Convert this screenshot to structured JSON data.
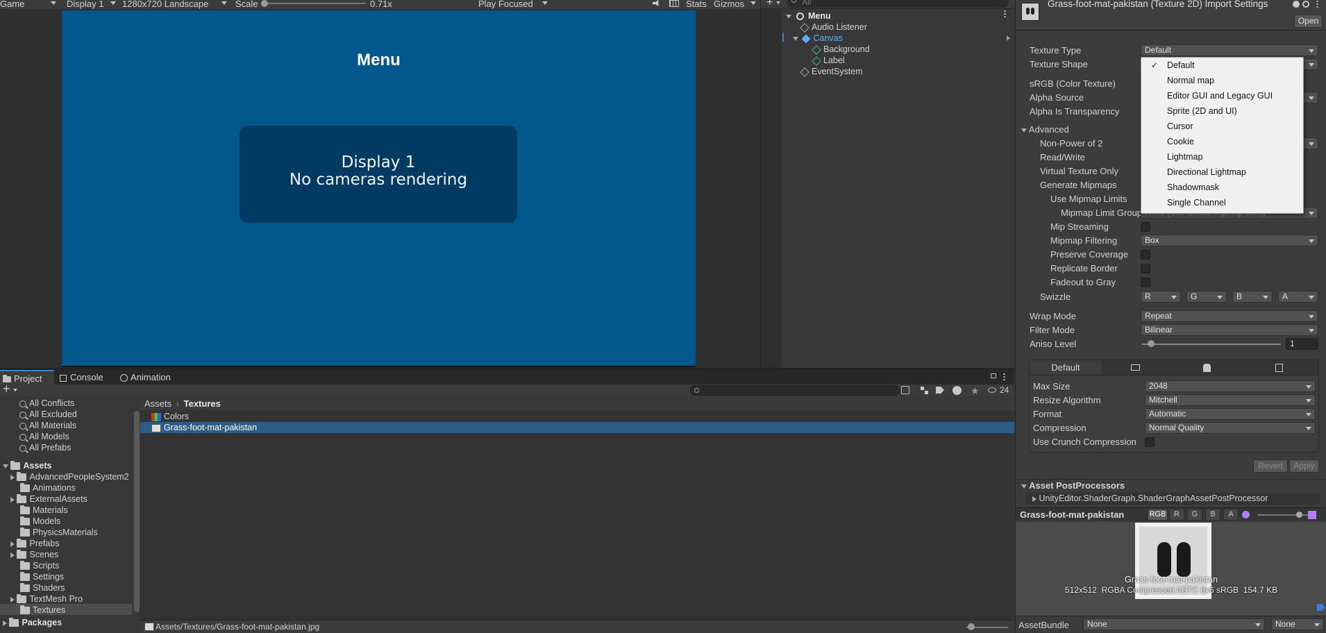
{
  "game_view": {
    "tab_label": "Game",
    "display": "Display 1",
    "resolution": "1280x720 Landscape",
    "scale_label": "Scale",
    "scale_value": "0.71x",
    "play_mode": "Play Focused",
    "stats": "Stats",
    "gizmos": "Gizmos",
    "canvas_title": "Menu",
    "no_camera_line1": "Display 1",
    "no_camera_line2": "No cameras rendering"
  },
  "hierarchy": {
    "search_placeholder": "All",
    "scene": "Menu",
    "items": [
      {
        "label": "Audio Listener"
      },
      {
        "label": "Canvas"
      },
      {
        "label": "Background"
      },
      {
        "label": "Label"
      },
      {
        "label": "EventSystem"
      }
    ]
  },
  "inspector": {
    "title": "Grass-foot-mat-pakistan (Texture 2D) Import Settings",
    "open_button": "Open",
    "texture_type_label": "Texture Type",
    "texture_type_value": "Default",
    "texture_shape_label": "Texture Shape",
    "srgb_label": "sRGB (Color Texture)",
    "alpha_source_label": "Alpha Source",
    "alpha_transparency_label": "Alpha Is Transparency",
    "advanced_label": "Advanced",
    "npot_label": "Non-Power of 2",
    "readwrite_label": "Read/Write",
    "virtual_texture_label": "Virtual Texture Only",
    "gen_mipmaps_label": "Generate Mipmaps",
    "use_mip_limits_label": "Use Mipmap Limits",
    "mip_limit_group_label": "Mipmap Limit Group",
    "mip_limit_group_value": "None (Use Global Mipmap Limit)",
    "mip_streaming_label": "Mip Streaming",
    "mip_filtering_label": "Mipmap Filtering",
    "mip_filtering_value": "Box",
    "preserve_coverage_label": "Preserve Coverage",
    "replicate_border_label": "Replicate Border",
    "fadeout_label": "Fadeout to Gray",
    "swizzle_label": "Swizzle",
    "swizzle": [
      "R",
      "G",
      "B",
      "A"
    ],
    "wrap_mode_label": "Wrap Mode",
    "wrap_mode_value": "Repeat",
    "filter_mode_label": "Filter Mode",
    "filter_mode_value": "Bilinear",
    "aniso_label": "Aniso Level",
    "aniso_value": "1",
    "platform_default_tab": "Default",
    "max_size_label": "Max Size",
    "max_size_value": "2048",
    "resize_label": "Resize Algorithm",
    "resize_value": "Mitchell",
    "format_label": "Format",
    "format_value": "Automatic",
    "compression_label": "Compression",
    "compression_value": "Normal Quality",
    "crunch_label": "Use Crunch Compression",
    "revert_button": "Revert",
    "apply_button": "Apply",
    "postprocessors_label": "Asset PostProcessors",
    "postprocessor_item": "UnityEditor.ShaderGraph.ShaderGraphAssetPostProcessor",
    "preview_name": "Grass-foot-mat-pakistan",
    "channel_buttons": [
      "RGB",
      "R",
      "G",
      "B",
      "A"
    ],
    "preview_caption": "Grass-foot-mat-pakistan",
    "preview_info": "512x512  RGBA Compressed ASTC 6x6 sRGB  154.7 KB",
    "asset_bundle_label": "AssetBundle",
    "asset_bundle_value": "None",
    "asset_bundle_variant": "None"
  },
  "texture_type_menu": {
    "options": [
      "Default",
      "Normal map",
      "Editor GUI and Legacy GUI",
      "Sprite (2D and UI)",
      "Cursor",
      "Cookie",
      "Lightmap",
      "Directional Lightmap",
      "Shadowmask",
      "Single Channel"
    ],
    "selected": "Default"
  },
  "project": {
    "tabs": [
      "Project",
      "Console",
      "Animation"
    ],
    "hidden_count": "24",
    "favorites": [
      "All Conflicts",
      "All Excluded",
      "All Materials",
      "All Models",
      "All Prefabs"
    ],
    "assets_root": "Assets",
    "asset_folders": [
      "AdvancedPeopleSystem2",
      "Animations",
      "ExternalAssets",
      "Materials",
      "Models",
      "PhysicsMaterials",
      "Prefabs",
      "Scenes",
      "Scripts",
      "Settings",
      "Shaders",
      "TextMesh Pro",
      "Textures"
    ],
    "packages": "Packages",
    "breadcrumb_root": "Assets",
    "breadcrumb_current": "Textures",
    "files": [
      "Colors",
      "Grass-foot-mat-pakistan"
    ],
    "status_path": "Assets/Textures/Grass-foot-mat-pakistan.jpg"
  },
  "colors": {
    "game_bg": "#02578c",
    "selection": "#2c5d87",
    "canvas_blue": "#5db0ff"
  }
}
